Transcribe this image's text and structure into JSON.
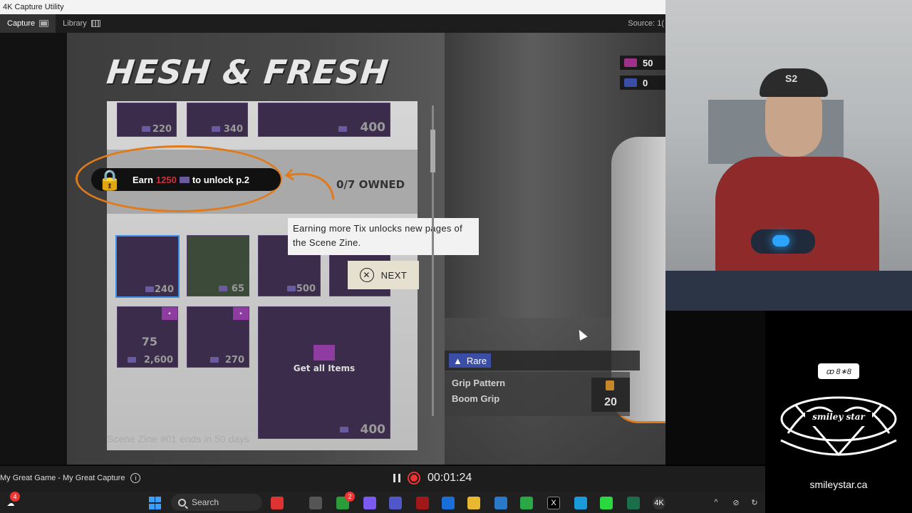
{
  "window": {
    "title": "4K Capture Utility"
  },
  "tabs": [
    {
      "label": "Capture"
    },
    {
      "label": "Library"
    }
  ],
  "source_label": "Source: 1(",
  "game": {
    "title": "HESH & FRESH",
    "unlock": {
      "prefix": "Earn",
      "amount": "1250",
      "suffix": "to unlock p.2"
    },
    "owned": "0/7 OWNED",
    "top_prices": [
      "220",
      "340",
      "400"
    ],
    "cards_row1": [
      "240",
      "65",
      "500"
    ],
    "cards_row2": [
      "75",
      "2,600",
      "270"
    ],
    "big_card_price": "400",
    "get_all": "Get all Items",
    "tooltip": "Earning more Tix unlocks new pages of the Scene Zine.",
    "next_label": "NEXT",
    "currency": [
      {
        "value": "50",
        "color": "#a0318a"
      },
      {
        "value": "0",
        "color": "#3a4ea8"
      }
    ],
    "rarity": "Rare",
    "item_type": "Grip Pattern",
    "item_name": "Boom Grip",
    "item_price": "20",
    "footer": "Scene Zine #01 ends in 50 days"
  },
  "webcam": {
    "cap_logo": "S2"
  },
  "branding": {
    "tag": "ꝏ 8∗8",
    "logo_text": "smiley star",
    "site": "smileystar.ca"
  },
  "status": {
    "capture_name": "My Great Game - My Great Capture",
    "timer": "00:01:24"
  },
  "taskbar": {
    "search_placeholder": "Search",
    "notif_count": "4",
    "chat_badge": "2"
  }
}
